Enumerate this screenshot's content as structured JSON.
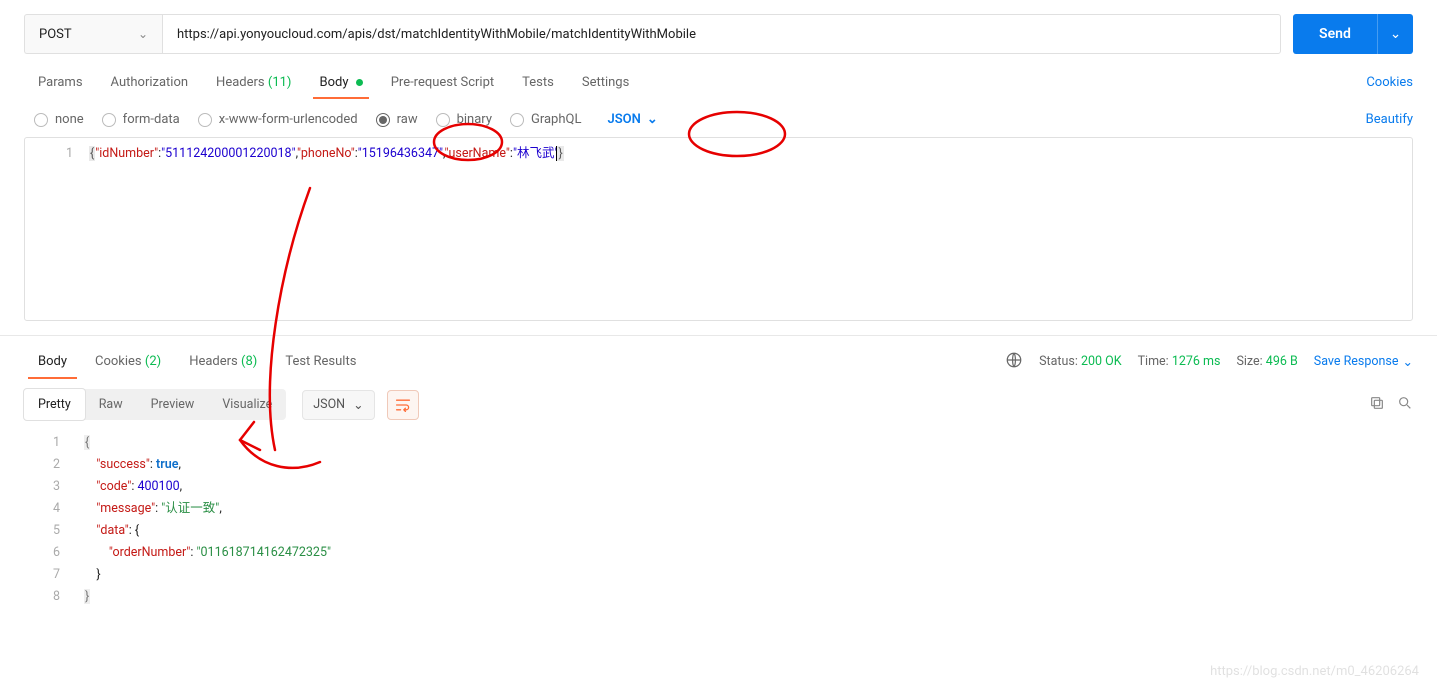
{
  "request": {
    "method": "POST",
    "url": "https://api.yonyoucloud.com/apis/dst/matchIdentityWithMobile/matchIdentityWithMobile",
    "send_label": "Send"
  },
  "req_tabs": {
    "params": "Params",
    "auth": "Authorization",
    "headers_label": "Headers",
    "headers_count": "(11)",
    "body": "Body",
    "prerequest": "Pre-request Script",
    "tests": "Tests",
    "settings": "Settings",
    "cookies": "Cookies"
  },
  "body_types": {
    "none": "none",
    "formdata": "form-data",
    "urlencoded": "x-www-form-urlencoded",
    "raw": "raw",
    "binary": "binary",
    "graphql": "GraphQL",
    "json": "JSON",
    "beautify": "Beautify"
  },
  "req_body": {
    "line_no": "1",
    "idKey": "\"idNumber\"",
    "idVal": "\"511124200001220018\"",
    "phoneKey": "\"phoneNo\"",
    "phoneVal": "\"15196436347\"",
    "userKey": "\"userName\"",
    "userVal": "\"林飞武\""
  },
  "resp_meta": {
    "body": "Body",
    "cookies_label": "Cookies",
    "cookies_count": "(2)",
    "headers_label": "Headers",
    "headers_count": "(8)",
    "testresults": "Test Results",
    "status_label": "Status:",
    "status_val": "200 OK",
    "time_label": "Time:",
    "time_val": "1276 ms",
    "size_label": "Size:",
    "size_val": "496 B",
    "save": "Save Response"
  },
  "resp_toolbar": {
    "pretty": "Pretty",
    "raw": "Raw",
    "preview": "Preview",
    "visualize": "Visualize",
    "format": "JSON"
  },
  "resp_body": {
    "l1": "1",
    "l2": "2",
    "l3": "3",
    "l4": "4",
    "l5": "5",
    "l6": "6",
    "l7": "7",
    "l8": "8",
    "successKey": "\"success\"",
    "successVal": "true",
    "codeKey": "\"code\"",
    "codeVal": "400100",
    "messageKey": "\"message\"",
    "messageVal": "\"认证一致\"",
    "dataKey": "\"data\"",
    "orderKey": "\"orderNumber\"",
    "orderVal": "\"011618714162472325\""
  },
  "watermark": "https://blog.csdn.net/m0_46206264"
}
